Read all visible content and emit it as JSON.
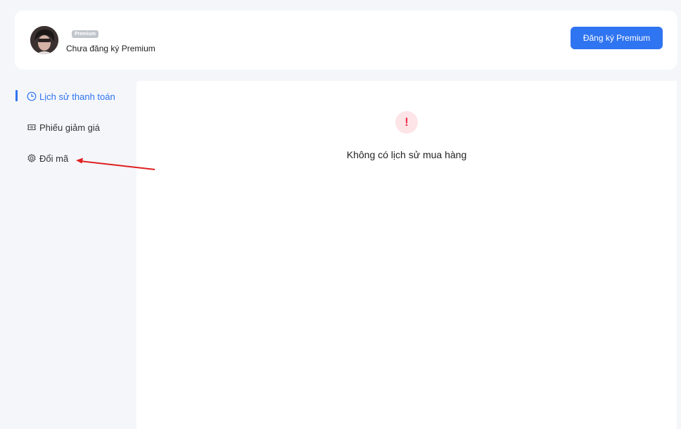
{
  "header": {
    "badge": "Premium",
    "status": "Chưa đăng ký Premium",
    "button_label": "Đăng ký Premium"
  },
  "sidebar": {
    "items": [
      {
        "label": "Lịch sử thanh toán",
        "icon": "clock-icon",
        "active": true
      },
      {
        "label": "Phiếu giảm giá",
        "icon": "ticket-icon",
        "active": false
      },
      {
        "label": "Đổi mã",
        "icon": "gear-icon",
        "active": false
      }
    ]
  },
  "main": {
    "empty_message": "Không có lịch sử mua hàng",
    "alert_icon": "exclamation-icon"
  },
  "colors": {
    "accent": "#2f74f0",
    "alert": "#f0304a",
    "annotation_arrow": "#e02020"
  }
}
